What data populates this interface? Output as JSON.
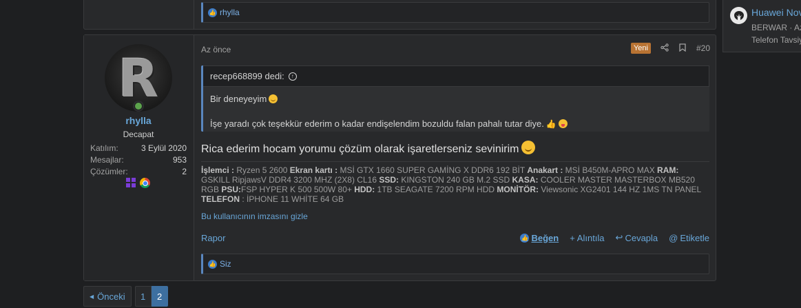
{
  "prev_post": {
    "reaction_user": "rhylla"
  },
  "post": {
    "user": {
      "avatar_letter": "R",
      "name": "rhylla",
      "title": "Decapat",
      "stats": [
        {
          "label": "Katılım:",
          "value": "3 Eylül 2020"
        },
        {
          "label": "Mesajlar:",
          "value": "953"
        },
        {
          "label": "Çözümler:",
          "value": "2"
        }
      ],
      "icons": [
        "windows-icon",
        "chrome-icon"
      ]
    },
    "time": "Az önce",
    "new_badge": "Yeni",
    "post_number": "#20",
    "quote": {
      "author": "recep668899 dedi:",
      "line1": "Bir deneyeyim",
      "line2": "İşe yaradı çok teşekkür ederim o kadar endişelendim bozuldu falan pahalı tutar diye."
    },
    "text": "Rica ederim hocam yorumu çözüm olarak işaretlerseniz sevinirim",
    "signature": [
      {
        "k": "İşlemci :",
        "v": " Ryzen 5 2600 "
      },
      {
        "k": "Ekran kartı :",
        "v": " MSİ GTX 1660 SUPER GAMİNG X DDR6 192 BİT "
      },
      {
        "k": "Anakart :",
        "v": " MSİ B450M-APRO MAX "
      },
      {
        "k": "RAM:",
        "v": " GSKILL RipjawsV DDR4 3200 MHZ (2X8) CL16 "
      },
      {
        "k": "SSD:",
        "v": " KINGSTON 240 GB M.2 SSD "
      },
      {
        "k": "KASA:",
        "v": " COOLER MASTER MASTERBOX MB520 RGB "
      },
      {
        "k": "PSU:",
        "v": "FSP HYPER K 500 500W 80+ "
      },
      {
        "k": "HDD:",
        "v": " 1TB SEAGATE 7200 RPM HDD "
      },
      {
        "k": "MONİTÖR:",
        "v": " Viewsonic XG2401 144 HZ 1MS TN PANEL "
      },
      {
        "k": "TELEFON",
        "v": " : İPHONE 11 WHİTE 64 GB"
      }
    ],
    "hide_signature": "Bu kullanıcının imzasını gizle",
    "report": "Rapor",
    "actions": {
      "like": "Beğen",
      "quote": "Alıntıla",
      "reply": "Cevapla",
      "tag": "Etiketle"
    },
    "reaction_user": "Siz"
  },
  "pagination": {
    "prev": "Önceki",
    "pages": [
      "1",
      "2"
    ],
    "current": "2"
  },
  "sidebar": {
    "title": "Huawei Nova",
    "meta": "BERWAR · Az önce",
    "forum": "Telefon Tavsiyeleri"
  }
}
